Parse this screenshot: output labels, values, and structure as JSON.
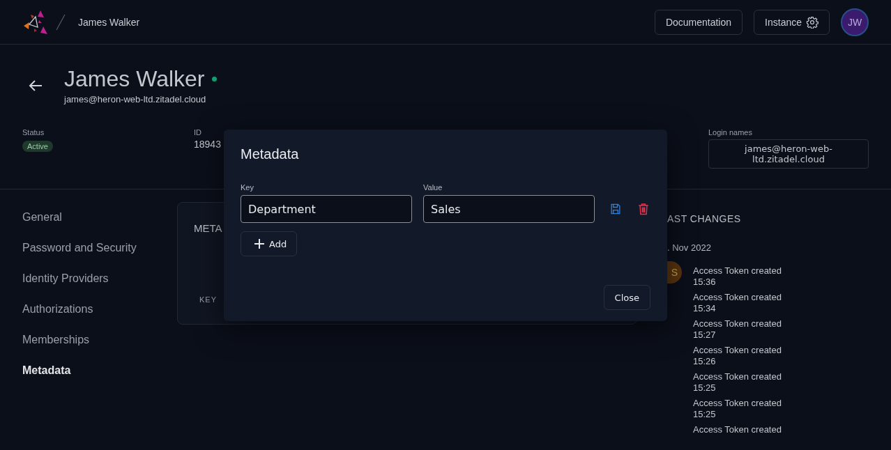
{
  "header": {
    "breadcrumb": "James Walker",
    "docs_button": "Documentation",
    "instance_button": "Instance",
    "avatar": "JW"
  },
  "profile": {
    "name": "James Walker",
    "online": true,
    "email": "james@heron-web-ltd.zitadel.cloud",
    "status_label": "Status",
    "status": "Active",
    "id_label": "ID",
    "id": "18943",
    "login_label": "Login names",
    "login": "james@heron-web-ltd.zitadel.cloud"
  },
  "sidebar": {
    "items": [
      {
        "label": "General",
        "selected": false
      },
      {
        "label": "Password and Security",
        "selected": false
      },
      {
        "label": "Identity Providers",
        "selected": false
      },
      {
        "label": "Authorizations",
        "selected": false
      },
      {
        "label": "Memberships",
        "selected": false
      },
      {
        "label": "Metadata",
        "selected": true
      }
    ]
  },
  "metadata_card": {
    "title": "META",
    "column": "KEY"
  },
  "changes": {
    "title": "AST CHANGES",
    "date": ". Nov 2022",
    "avatar": "S",
    "events": [
      {
        "text": "Access Token created",
        "time": "15:36"
      },
      {
        "text": "Access Token created",
        "time": "15:34"
      },
      {
        "text": "Access Token created",
        "time": "15:27"
      },
      {
        "text": "Access Token created",
        "time": "15:26"
      },
      {
        "text": "Access Token created",
        "time": "15:25"
      },
      {
        "text": "Access Token created",
        "time": "15:25"
      },
      {
        "text": "Access Token created"
      }
    ]
  },
  "dialog": {
    "title": "Metadata",
    "key_label": "Key",
    "value_label": "Value",
    "key": "Department",
    "value": "Sales",
    "add": "Add",
    "close": "Close"
  }
}
